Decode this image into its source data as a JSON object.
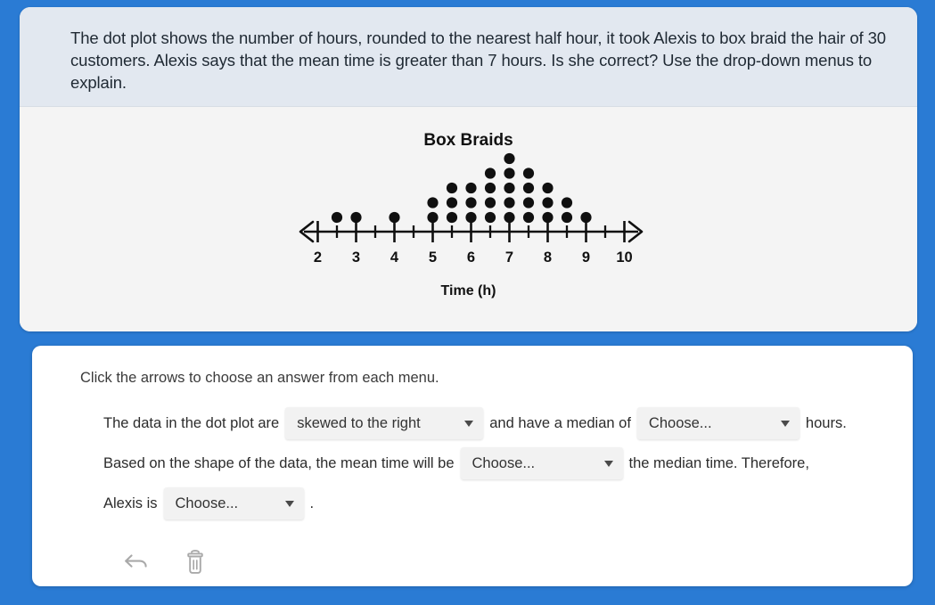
{
  "page": {
    "background_color": "#2a7bd4"
  },
  "prompt": {
    "text": "The dot plot shows the number of hours, rounded to the nearest half hour, it took Alexis to box braid the hair of 30 customers. Alexis says that the mean time is greater than 7 hours. Is she correct? Use the drop-down menus to explain."
  },
  "chart_data": {
    "type": "scatter",
    "plot_style": "dot-plot",
    "title": "Box Braids",
    "xlabel": "Time (h)",
    "ylabel": "",
    "x": [
      2.5,
      3,
      4,
      5,
      5.5,
      6,
      6.5,
      7,
      7.5,
      8,
      8.5,
      9
    ],
    "values": [
      1,
      1,
      1,
      2,
      3,
      3,
      4,
      5,
      4,
      3,
      2,
      1
    ],
    "total_dots": 30,
    "xlim": [
      1.5,
      10.5
    ],
    "major_ticks": [
      2,
      3,
      4,
      5,
      6,
      7,
      8,
      9,
      10
    ],
    "tick_labels": [
      "2",
      "3",
      "4",
      "5",
      "6",
      "7",
      "8",
      "9",
      "10"
    ],
    "minor_tick_step": 0.5,
    "grid": false,
    "legend": "none",
    "axis_arrows": "both",
    "dot_color": "#101010",
    "axis_color": "#101010"
  },
  "answer": {
    "instruction": "Click the arrows to choose an answer from each menu.",
    "line1": {
      "pre": "The data in the dot plot are",
      "mid": "and have a median of",
      "post": "hours."
    },
    "line2": {
      "pre": "Based on the shape of the data, the mean time will be",
      "post": "the median time. Therefore,"
    },
    "line3": {
      "pre": "Alexis is",
      "post": "."
    },
    "dropdowns": [
      {
        "name": "shape-dropdown",
        "value": "skewed to the right"
      },
      {
        "name": "median-dropdown",
        "value": "Choose..."
      },
      {
        "name": "mean-comparison-dropdown",
        "value": "Choose..."
      },
      {
        "name": "conclusion-dropdown",
        "value": "Choose..."
      }
    ],
    "tools": [
      {
        "name": "undo-button",
        "icon": "undo-arrow-icon"
      },
      {
        "name": "delete-button",
        "icon": "trash-can-icon"
      }
    ]
  }
}
